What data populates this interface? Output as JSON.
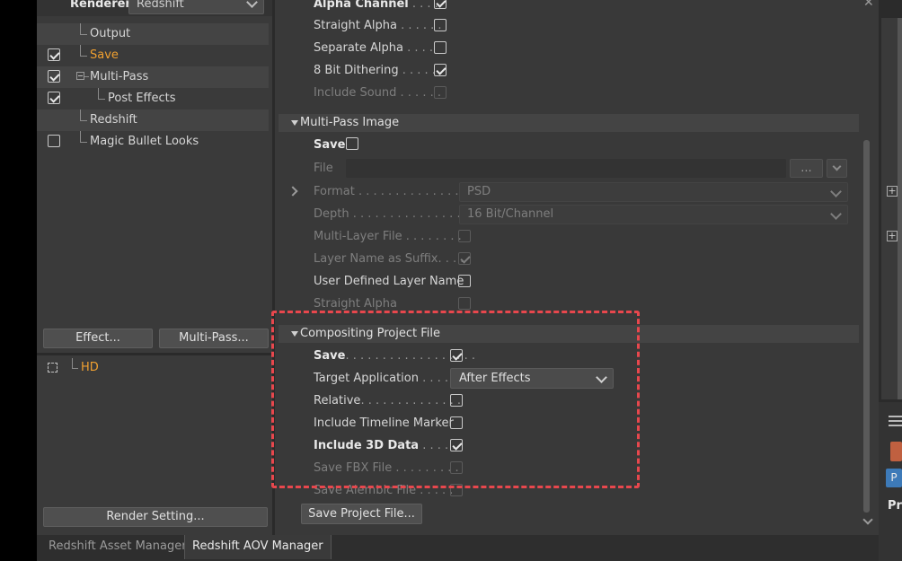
{
  "header": {
    "renderer_label": "Renderer",
    "renderer_value": "Redshift"
  },
  "tree": [
    {
      "label": "Output",
      "checked": null
    },
    {
      "label": "Save",
      "checked": true
    },
    {
      "label": "Multi-Pass",
      "checked": true
    },
    {
      "label": "Post Effects",
      "checked": true
    },
    {
      "label": "Redshift",
      "checked": null
    },
    {
      "label": "Magic Bullet Looks",
      "checked": false
    }
  ],
  "left_buttons": {
    "effect": "Effect...",
    "multipass": "Multi-Pass..."
  },
  "render_settings": {
    "item": "HD",
    "button": "Render Setting..."
  },
  "top_options": [
    {
      "label": "Alpha Channel",
      "dots": " . . . .",
      "checked": true
    },
    {
      "label": "Straight Alpha",
      "dots": " . . . . . .",
      "checked": false
    },
    {
      "label": "Separate Alpha",
      "dots": " . . . .",
      "checked": false
    },
    {
      "label": "8 Bit Dithering",
      "dots": " . . . . . .",
      "checked": true
    },
    {
      "label": "Include Sound",
      "dots": " . . . . . .",
      "checked": false
    }
  ],
  "multipass_image": {
    "title": "Multi-Pass Image",
    "save_label": "Save",
    "file_label": "File",
    "file_button": "...",
    "format_label": "Format",
    "format_dots": " . . . . . . . . . . . . . . . .",
    "format_value": "PSD",
    "depth_label": "Depth",
    "depth_dots": " . . . . . . . . . . . . . . . . .",
    "depth_value": "16 Bit/Channel",
    "multilayer_label": "Multi-Layer File",
    "multilayer_dots": " . . . . . . . .",
    "layername_label": "Layer Name as Suffix",
    "layername_dots": ". . . .",
    "userdefined_label": "User Defined Layer Name",
    "straight_label": "Straight Alpha"
  },
  "compositing": {
    "title": "Compositing Project File",
    "save_label": "Save",
    "save_dots": ". . . . . . . . . . . . . . . . . .",
    "target_label": "Target Application",
    "target_dots": " . . . .",
    "target_value": "After Effects",
    "relative_label": "Relative",
    "relative_dots": ". . . . . . . . . . . . . .",
    "timeline_label": "Include Timeline Marker",
    "include3d_label": "Include 3D Data",
    "include3d_dots": " . . . . .",
    "fbx_label": "Save FBX File",
    "fbx_dots": " . . . . . . . . .",
    "alembic_label": "Save Alembic File",
    "alembic_dots": " . . . . .",
    "save_project_button": "Save Project File..."
  },
  "tabs": [
    "Redshift Asset Manager",
    "Redshift AOV Manager"
  ],
  "right_strip": {
    "btn": "P",
    "label": "Pro"
  },
  "colors": {
    "accent_orange": "#f0a030",
    "highlight_red": "#e8474d"
  }
}
